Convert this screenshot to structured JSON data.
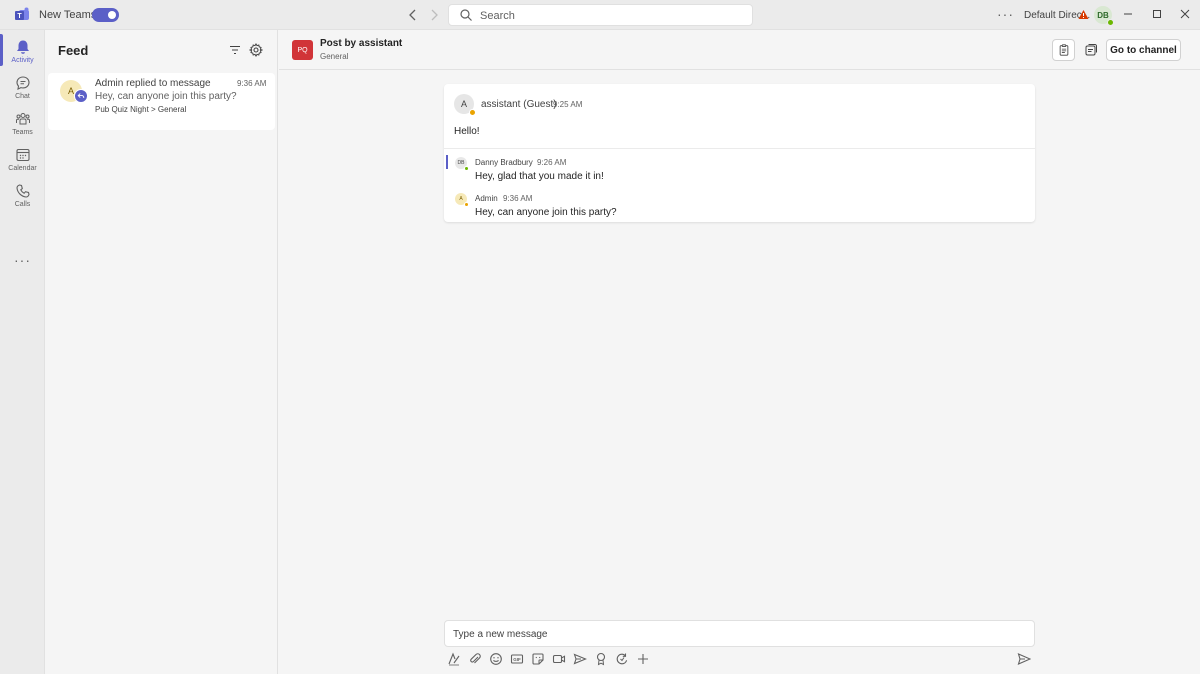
{
  "titlebar": {
    "app_label": "New Teams",
    "search_placeholder": "Search",
    "more": "···",
    "tenant": "Default Direc...",
    "user_initials": "DB"
  },
  "rail": {
    "items": [
      {
        "label": "Activity",
        "icon": "bell-icon"
      },
      {
        "label": "Chat",
        "icon": "chat-icon"
      },
      {
        "label": "Teams",
        "icon": "teams-icon"
      },
      {
        "label": "Calendar",
        "icon": "calendar-icon"
      },
      {
        "label": "Calls",
        "icon": "phone-icon"
      }
    ],
    "more": "···"
  },
  "feed": {
    "title": "Feed",
    "items": [
      {
        "avatar": "A",
        "title": "Admin replied to message",
        "time": "9:36 AM",
        "preview": "Hey, can anyone join this party?",
        "path": "Pub Quiz Night > General"
      }
    ]
  },
  "header": {
    "team_initials": "PQ",
    "title": "Post by assistant",
    "subtitle": "General",
    "go_to_channel": "Go to channel"
  },
  "post": {
    "avatar": "A",
    "author": "assistant (Guest)",
    "time": "9:25 AM",
    "body": "Hello!",
    "replies": [
      {
        "initials": "DB",
        "author": "Danny Bradbury",
        "time": "9:26 AM",
        "text": "Hey, glad that you made it in!"
      },
      {
        "initials": "A",
        "author": "Admin",
        "time": "9:36 AM",
        "text": "Hey, can anyone join this party?"
      }
    ]
  },
  "compose": {
    "placeholder": "Type a new message"
  },
  "colors": {
    "brand": "#5b5fc7",
    "team_tile": "#d13438",
    "presence_available": "#6bb700",
    "presence_away": "#eaa300"
  }
}
